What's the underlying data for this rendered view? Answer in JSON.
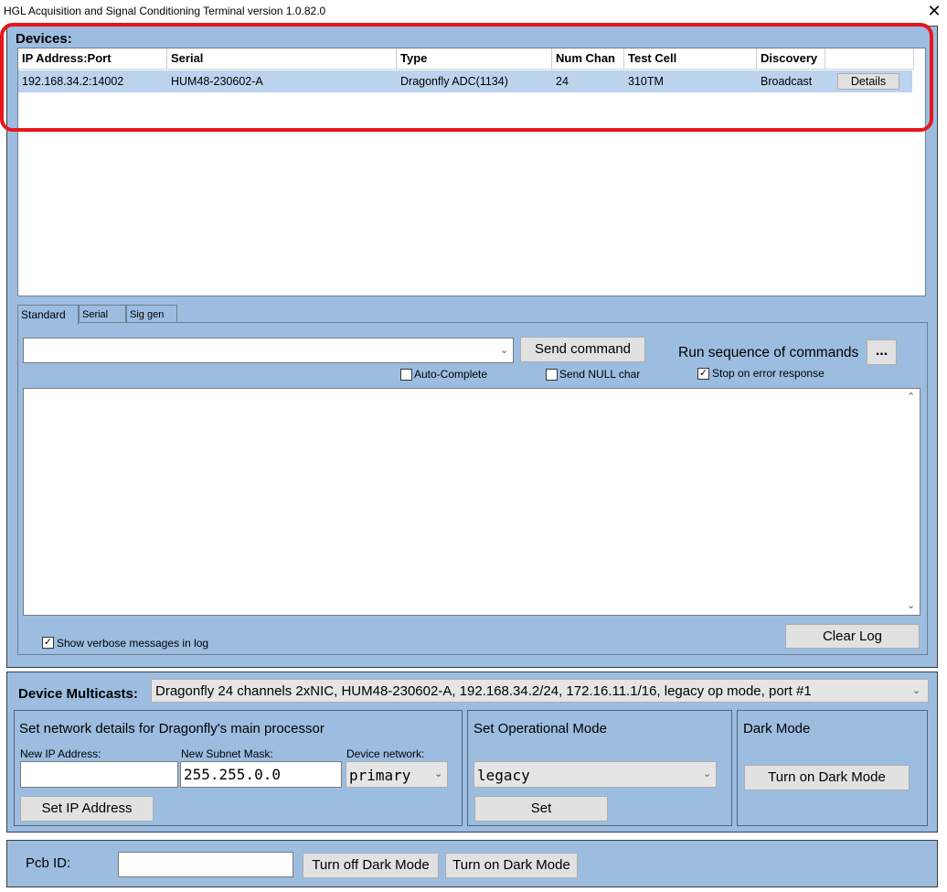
{
  "window": {
    "title": "HGL Acquisition and Signal Conditioning Terminal version 1.0.82.0",
    "close_glyph": "✕"
  },
  "devices": {
    "label": "Devices:",
    "columns": [
      "IP Address:Port",
      "Serial",
      "Type",
      "Num Chan",
      "Test Cell",
      "Discovery",
      ""
    ],
    "rows": [
      {
        "ip": "192.168.34.2:14002",
        "serial": "HUM48-230602-A",
        "type": "Dragonfly ADC(1134)",
        "num_chan": "24",
        "test_cell": "310TM",
        "discovery": "Broadcast",
        "details_label": "Details"
      }
    ]
  },
  "tabs": {
    "items": [
      "Standard",
      "Serial",
      "Sig gen"
    ],
    "active": "Standard"
  },
  "standard": {
    "command_value": "",
    "send_label": "Send command",
    "run_sequence_label": "Run sequence of commands",
    "browse_label": "...",
    "auto_complete": {
      "label": "Auto-Complete",
      "checked": false
    },
    "send_null": {
      "label": "Send NULL char",
      "checked": false
    },
    "stop_on_error": {
      "label": "Stop on error response",
      "checked": true
    },
    "verbose": {
      "label": "Show verbose messages in log",
      "checked": true
    },
    "clear_log_label": "Clear Log",
    "check_glyph": "✓"
  },
  "multicasts": {
    "label": "Device Multicasts:",
    "selected": "Dragonfly 24 channels 2xNIC, HUM48-230602-A, 192.168.34.2/24, 172.16.11.1/16, legacy op mode, port #1"
  },
  "network": {
    "title": "Set network details for Dragonfly's main processor",
    "ip_label": "New IP Address:",
    "ip_value": "",
    "subnet_label": "New Subnet Mask:",
    "subnet_value": "255.255.0.0",
    "device_network_label": "Device network:",
    "device_network_value": "primary",
    "set_ip_label": "Set IP Address"
  },
  "op_mode": {
    "title": "Set Operational Mode",
    "value": "legacy",
    "set_label": "Set"
  },
  "dark_mode": {
    "title": "Dark Mode",
    "button_label": "Turn on Dark Mode"
  },
  "footer": {
    "pcb_label": "Pcb ID:",
    "pcb_value": "",
    "turn_off_label": "Turn off Dark Mode",
    "turn_on_label": "Turn on Dark Mode"
  },
  "colors": {
    "panel": "#9cbde0",
    "row_highlight": "#bcd3ee",
    "annotation_red": "#e8151b"
  }
}
